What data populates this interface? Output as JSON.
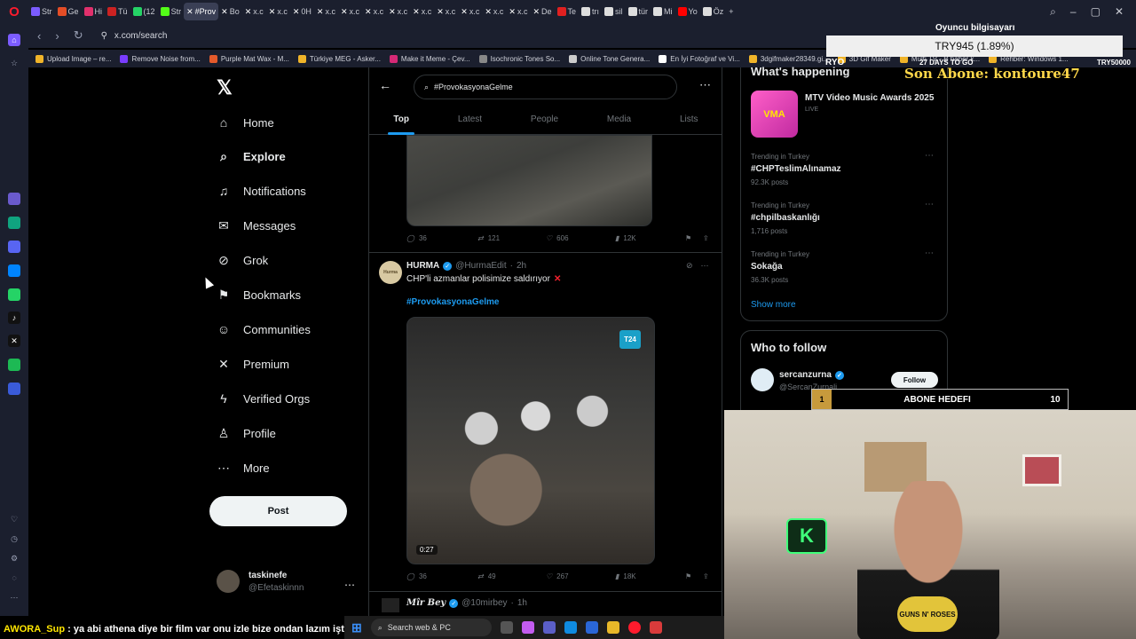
{
  "browser": {
    "tabs": [
      {
        "label": "Str",
        "color": "#7b5cff"
      },
      {
        "label": "Ge",
        "color": "#e44d26"
      },
      {
        "label": "Hi",
        "color": "#e1306c"
      },
      {
        "label": "Tü",
        "color": "#cc2222"
      },
      {
        "label": "(12",
        "color": "#25d366"
      },
      {
        "label": "Str",
        "color": "#53fc18"
      },
      {
        "label": "#Prov",
        "color": "x",
        "active": true
      },
      {
        "label": "Bo",
        "color": "x"
      },
      {
        "label": "x.c",
        "color": "x"
      },
      {
        "label": "x.c",
        "color": "x"
      },
      {
        "label": "0H",
        "color": "x"
      },
      {
        "label": "x.c",
        "color": "x"
      },
      {
        "label": "x.c",
        "color": "x"
      },
      {
        "label": "x.c",
        "color": "x"
      },
      {
        "label": "x.c",
        "color": "x"
      },
      {
        "label": "x.c",
        "color": "x"
      },
      {
        "label": "x.c",
        "color": "x"
      },
      {
        "label": "x.c",
        "color": "x"
      },
      {
        "label": "x.c",
        "color": "x"
      },
      {
        "label": "x.c",
        "color": "x"
      },
      {
        "label": "De",
        "color": "x"
      },
      {
        "label": "Te",
        "color": "#e02020"
      },
      {
        "label": "trı",
        "color": "#dddddd"
      },
      {
        "label": "sil",
        "color": "#dddddd"
      },
      {
        "label": "tür",
        "color": "#dddddd"
      },
      {
        "label": "Mi",
        "color": "#dddddd"
      },
      {
        "label": "Yo",
        "color": "#ff0000"
      },
      {
        "label": "Öz",
        "color": "#dddddd"
      }
    ],
    "url": "x.com/search",
    "bookmarks": [
      {
        "label": "Upload Image – re...",
        "color": "#f0b429"
      },
      {
        "label": "Remove Noise from...",
        "color": "#7a3cff"
      },
      {
        "label": "Purple Mat Wax - M...",
        "color": "#e45a2b"
      },
      {
        "label": "Türkiye MEG - Asker...",
        "color": "#f0b429"
      },
      {
        "label": "Make it Meme - Çev...",
        "color": "#d62976"
      },
      {
        "label": "Isochronic Tones So...",
        "color": "#888888"
      },
      {
        "label": "Online Tone Genera...",
        "color": "#cccccc"
      },
      {
        "label": "En İyi Fotoğraf ve Vi...",
        "color": "#ffffff"
      },
      {
        "label": "3dgifmaker28349.gi...",
        "color": "#f0b429"
      },
      {
        "label": "3D Gif Maker",
        "color": "#f0b429"
      },
      {
        "label": "Multi TV - B haber k...",
        "color": "#f0b429"
      },
      {
        "label": "Rehber: Windows 1...",
        "color": "#f0b429"
      }
    ]
  },
  "nav": {
    "items": [
      {
        "label": "Home",
        "icon": "⌂"
      },
      {
        "label": "Explore",
        "icon": "⌕"
      },
      {
        "label": "Notifications",
        "icon": "♫"
      },
      {
        "label": "Messages",
        "icon": "✉"
      },
      {
        "label": "Grok",
        "icon": "⊘"
      },
      {
        "label": "Bookmarks",
        "icon": "⚑"
      },
      {
        "label": "Communities",
        "icon": "☺"
      },
      {
        "label": "Premium",
        "icon": "✕"
      },
      {
        "label": "Verified Orgs",
        "icon": "ϟ"
      },
      {
        "label": "Profile",
        "icon": "♙"
      },
      {
        "label": "More",
        "icon": "⋯"
      }
    ],
    "post_label": "Post",
    "account": {
      "name": "taskinefe",
      "handle": "@Efetaskinnn"
    }
  },
  "search": {
    "query": "#ProvokasyonaGelme",
    "tabs": [
      "Top",
      "Latest",
      "People",
      "Media",
      "Lists"
    ]
  },
  "tweet1": {
    "replies": "36",
    "reposts": "121",
    "likes": "606",
    "views": "12K"
  },
  "tweet2": {
    "name": "HURMA",
    "handle": "@HurmaEdit",
    "time": "2h",
    "avatar_text": "Hurma",
    "text": "CHP'li azmanlar polisimize saldırıyor",
    "hashtag": "#ProvokasyonaGelme",
    "media_badge": "T24",
    "duration": "0:27",
    "replies": "36",
    "reposts": "49",
    "likes": "267",
    "views": "18K"
  },
  "tweet3": {
    "name": "Mîr Bey",
    "handle": "@10mirbey",
    "time": "1h"
  },
  "whats_happening": {
    "title": "What's happening",
    "featured": {
      "title": "MTV Video Music Awards 2025",
      "status": "LIVE",
      "image_text": "VMA"
    },
    "trends": [
      {
        "context": "Trending in Turkey",
        "topic": "#CHPTeslimAlınamaz",
        "posts": "92.3K posts"
      },
      {
        "context": "Trending in Turkey",
        "topic": "#chpilbaskanlığı",
        "posts": "1,716 posts"
      },
      {
        "context": "Trending in Turkey",
        "topic": "Sokağa",
        "posts": "36.3K posts"
      }
    ],
    "show_more": "Show more"
  },
  "who_to_follow": {
    "title": "Who to follow",
    "suggestion": {
      "name": "sercanzurna",
      "handle": "@SercanZurnali",
      "button": "Follow"
    }
  },
  "overlay": {
    "pc_name": "Oyuncu bilgisayarı",
    "price": "TRY945 (1.89%)",
    "ryo": "RYO",
    "days": "27 DAYS TO GO",
    "try5": "TRY50000",
    "son_abone": "Son Abone: kontoure47",
    "abone_num": "1",
    "abone_label": "ABONE HEDEFI",
    "abone_goal": "10",
    "shirt": "GUNS N' ROSES",
    "cam_logo": "K"
  },
  "chat": {
    "user": "AWORA_Sup",
    "message": " : ya abi athena diye bir film var onu izle bize ondan lazım işte"
  },
  "taskbar": {
    "search": "Search web & PC"
  }
}
